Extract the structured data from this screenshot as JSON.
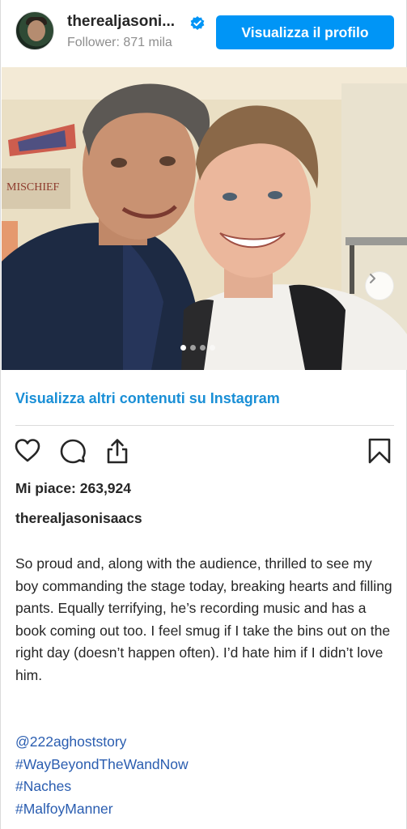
{
  "header": {
    "username": "therealjasoni...",
    "followers": "Follower: 871 mila",
    "profile_button": "Visualizza il profilo",
    "verified_icon": "verified-badge-icon",
    "accent_color": "#0095f6"
  },
  "photo": {
    "slide_count": 4,
    "active_slide": 1,
    "next_icon": "chevron-right-icon"
  },
  "more_link": "Visualizza altri contenuti su Instagram",
  "actions": {
    "like_icon": "heart-icon",
    "comment_icon": "comment-icon",
    "share_icon": "share-icon",
    "save_icon": "bookmark-icon"
  },
  "likes": "Mi piace: 263,924",
  "poster": "therealjasonisaacs",
  "caption": "So proud and, along with the audience, thrilled to see my boy commanding the stage today, breaking hearts and filling pants. Equally terrifying, he’s recording music and has a book coming out too. I feel smug if I take the bins out on the right day (doesn’t happen often). I’d hate him if I didn’t love him.",
  "tags": [
    "@222aghoststory",
    "#WayBeyondTheWandNow",
    "#Naches",
    "#MalfoyManner"
  ]
}
